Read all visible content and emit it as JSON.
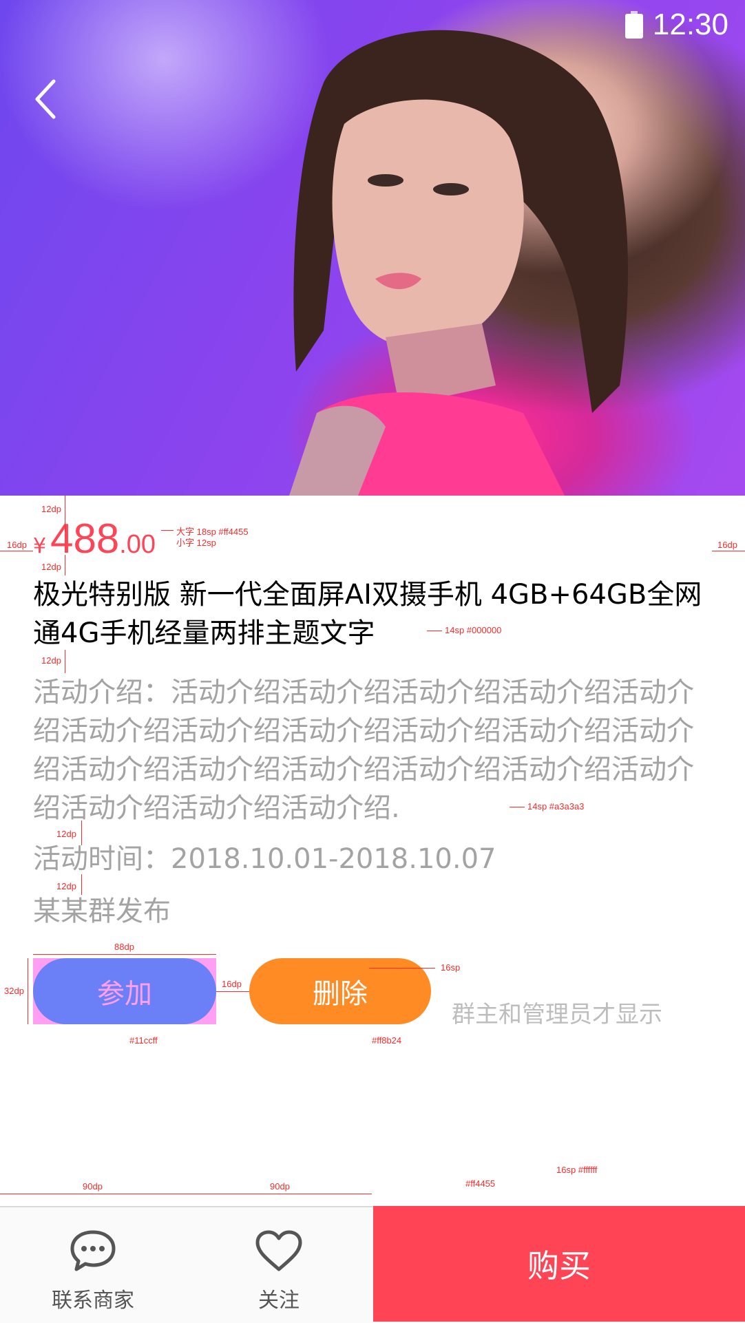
{
  "status_bar": {
    "time": "12:30",
    "battery_icon": "battery-icon"
  },
  "nav": {
    "back_icon": "chevron-left-icon"
  },
  "price": {
    "symbol": "¥",
    "major": "488",
    "minor": ".00",
    "color": "#ff4455"
  },
  "product": {
    "title": "极光特别版 新一代全面屏AI双摄手机 4GB+64GB全网通4G手机经量两排主题文字",
    "description": "活动介绍：活动介绍活动介绍活动介绍活动介绍活动介绍活动介绍活动介绍活动介绍活动介绍活动介绍活动介绍活动介绍活动介绍活动介绍活动介绍活动介绍活动介绍活动介绍活动介绍活动介绍.",
    "time": "活动时间：2018.10.01-2018.10.07",
    "publisher": "某某群发布"
  },
  "actions": {
    "join": {
      "label": "参加",
      "color": "#11ccff"
    },
    "delete": {
      "label": "删除",
      "color": "#ff8b24"
    },
    "admin_note": "群主和管理员才显示"
  },
  "annotations": {
    "price_note_big": "大字 18sp #ff4455",
    "price_note_small": "小字 12sp",
    "title_note": "14sp #000000",
    "desc_note": "14sp #a3a3a3",
    "spacing_12": "12dp",
    "spacing_16": "16dp",
    "button_width": "88dp",
    "button_height": "32dp",
    "button_text": "16sp",
    "join_color": "#11ccff",
    "delete_color": "#ff8b24",
    "tab_width": "90dp",
    "buy_color": "#ff4455",
    "buy_text": "16sp #ffffff"
  },
  "bottom_bar": {
    "contact": {
      "label": "联系商家",
      "icon": "chat-bubble-icon"
    },
    "follow": {
      "label": "关注",
      "icon": "heart-icon"
    },
    "buy": {
      "label": "购买",
      "color": "#ff4455"
    }
  }
}
